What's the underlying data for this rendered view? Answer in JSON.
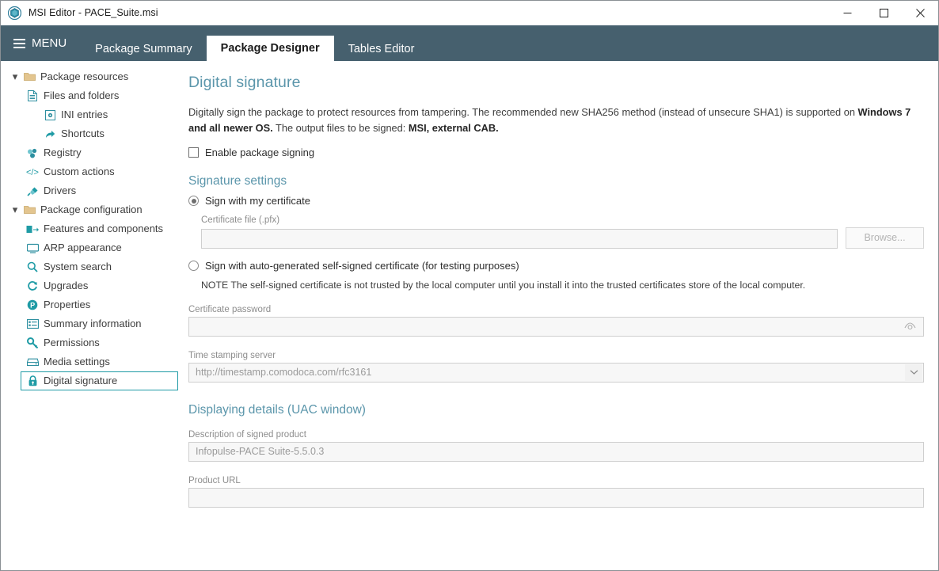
{
  "window": {
    "title": "MSI Editor - PACE_Suite.msi",
    "app_icon": "app-hexagon-icon",
    "controls": {
      "minimize": "minimize-icon",
      "maximize": "maximize-icon",
      "close": "close-icon"
    }
  },
  "menubar": {
    "menu_label": "MENU",
    "tabs": [
      {
        "label": "Package Summary",
        "active": false
      },
      {
        "label": "Package Designer",
        "active": true
      },
      {
        "label": "Tables Editor",
        "active": false
      }
    ]
  },
  "sidebar": {
    "items": [
      {
        "label": "Package resources",
        "level": 0,
        "icon": "folder-icon",
        "caret": "▾",
        "selected": false
      },
      {
        "label": "Files and folders",
        "level": 1,
        "icon": "document-icon",
        "caret": "",
        "selected": false
      },
      {
        "label": "INI entries",
        "level": 2,
        "icon": "ini-gear-icon",
        "caret": "",
        "selected": false
      },
      {
        "label": "Shortcuts",
        "level": 2,
        "icon": "shortcut-arrow-icon",
        "caret": "",
        "selected": false
      },
      {
        "label": "Registry",
        "level": 1,
        "icon": "registry-icon",
        "caret": "",
        "selected": false
      },
      {
        "label": "Custom actions",
        "level": 1,
        "icon": "code-icon",
        "caret": "",
        "selected": false
      },
      {
        "label": "Drivers",
        "level": 1,
        "icon": "plug-icon",
        "caret": "",
        "selected": false
      },
      {
        "label": "Package configuration",
        "level": 0,
        "icon": "folder-icon",
        "caret": "▾",
        "selected": false
      },
      {
        "label": "Features and components",
        "level": 1,
        "icon": "features-icon",
        "caret": "",
        "selected": false
      },
      {
        "label": "ARP appearance",
        "level": 1,
        "icon": "monitor-icon",
        "caret": "",
        "selected": false
      },
      {
        "label": "System search",
        "level": 1,
        "icon": "search-icon",
        "caret": "",
        "selected": false
      },
      {
        "label": "Upgrades",
        "level": 1,
        "icon": "refresh-icon",
        "caret": "",
        "selected": false
      },
      {
        "label": "Properties",
        "level": 1,
        "icon": "properties-p-icon",
        "caret": "",
        "selected": false
      },
      {
        "label": "Summary information",
        "level": 1,
        "icon": "list-icon",
        "caret": "",
        "selected": false
      },
      {
        "label": "Permissions",
        "level": 1,
        "icon": "key-icon",
        "caret": "",
        "selected": false
      },
      {
        "label": "Media settings",
        "level": 1,
        "icon": "media-disk-icon",
        "caret": "",
        "selected": false
      },
      {
        "label": "Digital signature",
        "level": 1,
        "icon": "lock-icon",
        "caret": "",
        "selected": true
      }
    ]
  },
  "main": {
    "page_title": "Digital signature",
    "intro": {
      "part1": "Digitally sign the package to protect resources from tampering. The recommended new SHA256 method (instead of unsecure SHA1) is supported on ",
      "bold1": "Windows 7 and all newer OS.",
      "part2": " The output files to be signed: ",
      "bold2": "MSI, external CAB."
    },
    "enable_signing": {
      "label": "Enable package signing",
      "checked": false
    },
    "signature_settings": {
      "heading": "Signature settings",
      "option_my_cert": {
        "label": "Sign with my certificate",
        "selected": true
      },
      "certificate_file": {
        "label": "Certificate file (.pfx)",
        "value": "",
        "placeholder": ""
      },
      "browse_button": "Browse...",
      "option_self_signed": {
        "label": "Sign with auto-generated self-signed certificate (for testing purposes)",
        "selected": false
      },
      "self_signed_note": "NOTE The self-signed certificate is not trusted by the local computer until you install it into the trusted certificates store of the local computer.",
      "certificate_password": {
        "label": "Certificate password",
        "value": "",
        "reveal_icon": "eye-icon"
      },
      "time_stamping_server": {
        "label": "Time stamping server",
        "value": "http://timestamp.comodoca.com/rfc3161",
        "chevron_icon": "chevron-down-icon"
      }
    },
    "displaying_details": {
      "heading": "Displaying details (UAC window)",
      "description": {
        "label": "Description of signed product",
        "value": "Infopulse-PACE Suite-5.5.0.3"
      },
      "product_url": {
        "label": "Product URL",
        "value": ""
      }
    }
  },
  "colors": {
    "menubar": "#46606e",
    "accent_heading": "#5b96ab",
    "accent_teal": "#1f9ba5",
    "folder": "#d9b87c",
    "field_bg": "#f7f7f7"
  }
}
